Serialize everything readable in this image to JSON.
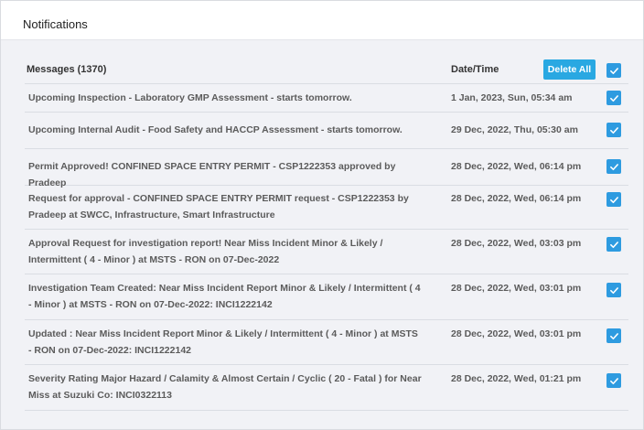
{
  "header": {
    "title": "Notifications"
  },
  "table": {
    "messages_header": "Messages (1370)",
    "date_header": "Date/Time",
    "delete_all_label": "Delete All",
    "rows": [
      {
        "message": "Upcoming Inspection - Laboratory GMP Assessment - starts tomorrow.",
        "date": "1 Jan, 2023, Sun, 05:34 am",
        "checked": true
      },
      {
        "message": "Upcoming Internal Audit - Food Safety and HACCP Assessment - starts tomorrow.",
        "date": "29 Dec, 2022, Thu, 05:30 am",
        "checked": true
      },
      {
        "message": "Permit Approved! CONFINED SPACE ENTRY PERMIT - CSP1222353 approved by Pradeep",
        "date": "28 Dec, 2022, Wed, 06:14 pm",
        "checked": true
      },
      {
        "message": "Request for approval - CONFINED SPACE ENTRY PERMIT request - CSP1222353 by Pradeep at SWCC, Infrastructure, Smart Infrastructure",
        "date": "28 Dec, 2022, Wed, 06:14 pm",
        "checked": true
      },
      {
        "message": "Approval Request for investigation report! Near Miss Incident Minor & Likely / Intermittent ( 4 - Minor ) at MSTS - RON on 07-Dec-2022",
        "date": "28 Dec, 2022, Wed, 03:03 pm",
        "checked": true
      },
      {
        "message": "Investigation Team Created: Near Miss Incident Report Minor & Likely / Intermittent ( 4 - Minor ) at MSTS - RON on 07-Dec-2022: INCI1222142",
        "date": "28 Dec, 2022, Wed, 03:01 pm",
        "checked": true
      },
      {
        "message": "Updated : Near Miss Incident Report Minor & Likely / Intermittent ( 4 - Minor ) at MSTS - RON on 07-Dec-2022: INCI1222142",
        "date": "28 Dec, 2022, Wed, 03:01 pm",
        "checked": true
      },
      {
        "message": "Severity Rating Major Hazard / Calamity & Almost Certain / Cyclic ( 20 - Fatal ) for Near Miss at Suzuki Co: INCI0322113",
        "date": "28 Dec, 2022, Wed, 01:21 pm",
        "checked": true
      }
    ]
  },
  "colors": {
    "accent": "#29a8e2",
    "checkbox": "#2e9be0",
    "background": "#f1f2f6"
  },
  "icons": {
    "checkbox": "check-icon"
  }
}
